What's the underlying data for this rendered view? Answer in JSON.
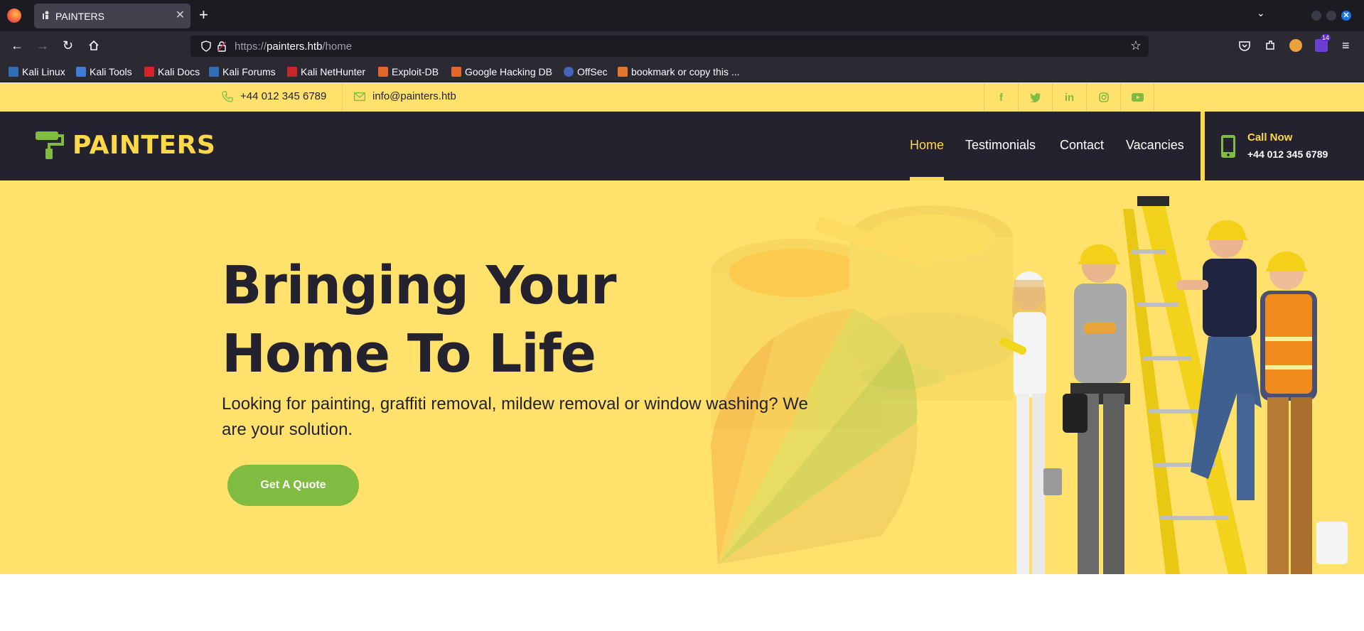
{
  "browser": {
    "tab_title": "PAINTERS",
    "url_prefix": "https://",
    "url_host": "painters.htb",
    "url_path": "/home",
    "extension_badge": "14",
    "bookmarks": [
      "Kali Linux",
      "Kali Tools",
      "Kali Docs",
      "Kali Forums",
      "Kali NetHunter",
      "Exploit-DB",
      "Google Hacking DB",
      "OffSec",
      "bookmark or copy this ..."
    ]
  },
  "topbar": {
    "phone": "+44 012 345 6789",
    "email": "info@painters.htb",
    "social_icons": [
      "facebook-icon",
      "twitter-icon",
      "linkedin-icon",
      "instagram-icon",
      "youtube-icon"
    ]
  },
  "header": {
    "brand": "PAINTERS",
    "menu": [
      "Home",
      "Testimonials",
      "Contact",
      "Vacancies"
    ],
    "active_menu": "Home",
    "call_title": "Call Now",
    "call_number": "+44 012 345 6789"
  },
  "hero": {
    "title": "Bringing Your Home To Life",
    "subtitle": "Looking for painting, graffiti removal, mildew removal or window washing? We are your solution.",
    "button": "Get A Quote"
  },
  "colors": {
    "yellow": "#ffe16b",
    "dark": "#23222e",
    "accent_yellow": "#ffd84a",
    "green": "#7fbc41"
  }
}
